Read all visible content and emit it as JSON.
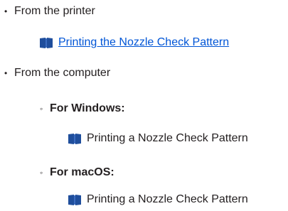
{
  "list": {
    "item1": {
      "bullet": "•",
      "label": "From the printer",
      "link": {
        "icon": "book-icon",
        "text": "Printing the Nozzle Check Pattern",
        "color": "#0055d6"
      }
    },
    "item2": {
      "bullet": "•",
      "label": "From the computer",
      "sub": [
        {
          "bullet": "◦",
          "label": "For Windows:",
          "entry": {
            "icon": "book-icon",
            "text": "Printing a Nozzle Check Pattern"
          }
        },
        {
          "bullet": "◦",
          "label": "For macOS:",
          "entry": {
            "icon": "book-icon",
            "text": "Printing a Nozzle Check Pattern"
          }
        }
      ]
    }
  },
  "colors": {
    "icon": "#1f4e9c",
    "text": "#231f20",
    "link": "#0055d6"
  }
}
